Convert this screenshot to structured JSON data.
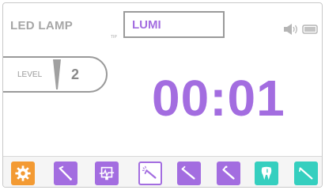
{
  "header": {
    "title": "LED LAMP",
    "tip_label": "TIP",
    "tip_value": "LUMI"
  },
  "level": {
    "label": "LEVEL",
    "value": "2"
  },
  "timer": {
    "value": "00:01"
  },
  "toolbar": {
    "items": [
      {
        "name": "settings",
        "icon": "gear-icon",
        "color": "#f39a33"
      },
      {
        "name": "handpiece-1",
        "icon": "handpiece-icon",
        "color": "#a36de0"
      },
      {
        "name": "monitor",
        "icon": "tooth-monitor-icon",
        "color": "#a36de0"
      },
      {
        "name": "led-lamp",
        "icon": "led-lamp-icon",
        "color": "#a36de0",
        "selected": true
      },
      {
        "name": "handpiece-2",
        "icon": "handpiece-icon",
        "color": "#a36de0"
      },
      {
        "name": "handpiece-3",
        "icon": "handpiece-icon",
        "color": "#a36de0"
      },
      {
        "name": "tooth",
        "icon": "tooth-icon",
        "color": "#35cfbf"
      },
      {
        "name": "scaler",
        "icon": "scaler-icon",
        "color": "#35cfbf"
      }
    ]
  },
  "colors": {
    "accent": "#a36de0",
    "orange": "#f39a33",
    "teal": "#35cfbf",
    "gray_text": "#a6a6a6"
  }
}
